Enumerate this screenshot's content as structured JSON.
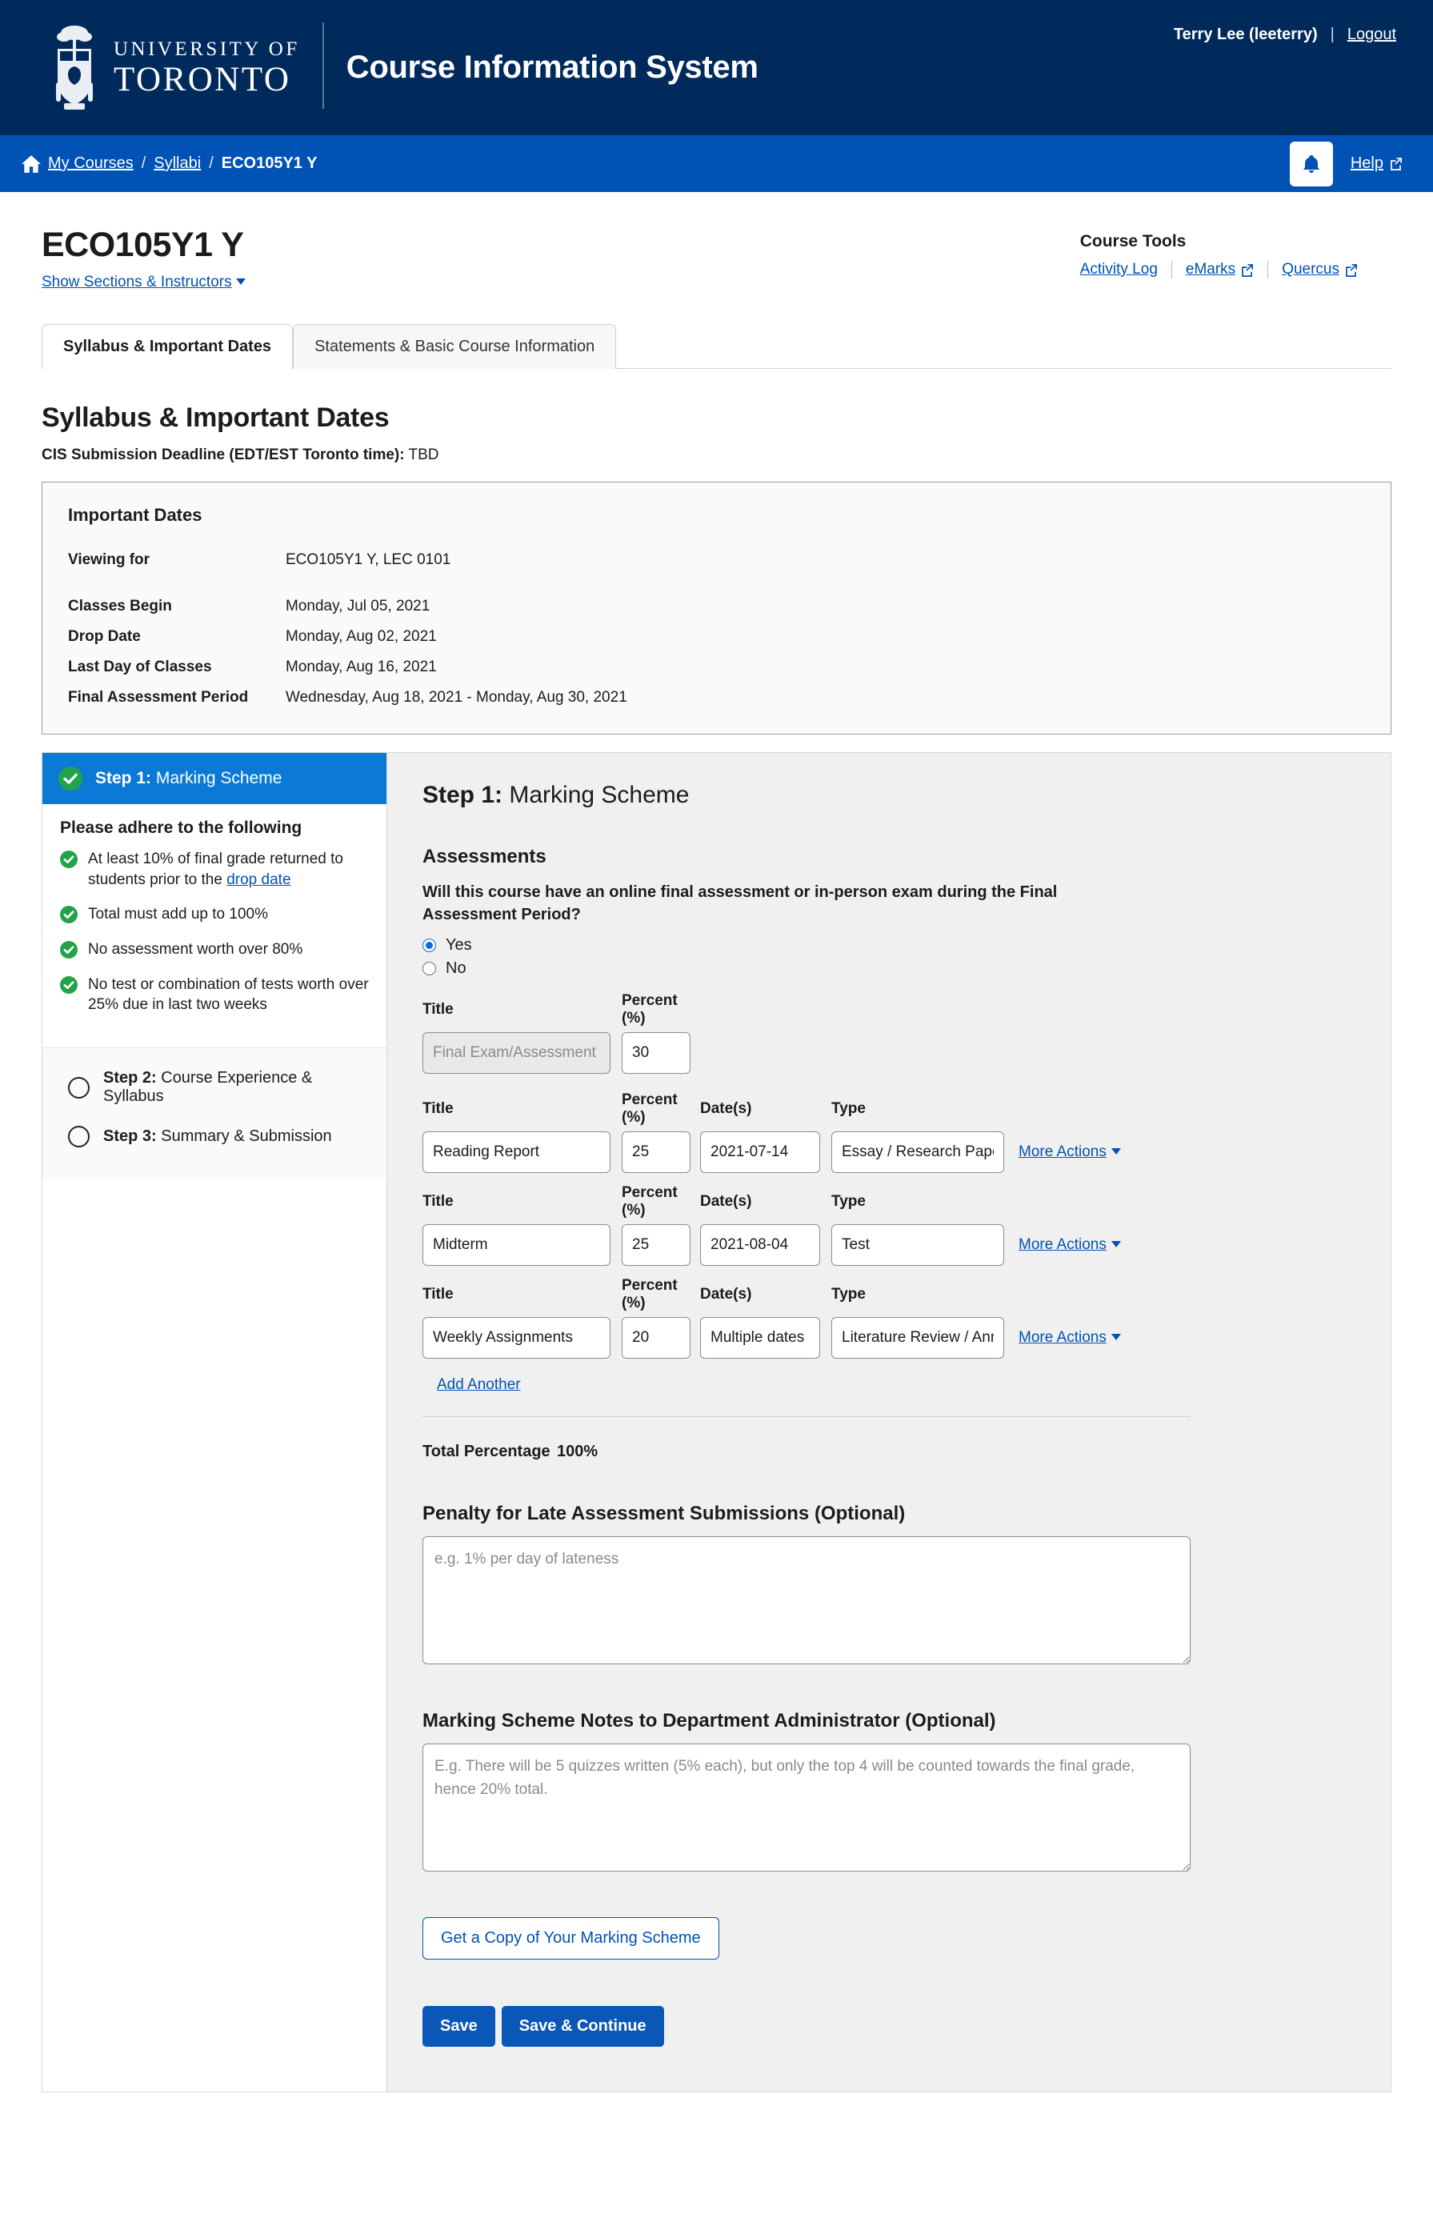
{
  "header": {
    "logo_line1": "UNIVERSITY OF",
    "logo_line2": "TORONTO",
    "app_title": "Course Information System",
    "user_name": "Terry Lee (leeterry)",
    "separator": "|",
    "logout_label": "Logout",
    "brand_navy": "#002a5c"
  },
  "breadcrumb": {
    "home_icon": "home-icon",
    "items": [
      {
        "label": "My Courses",
        "link": true
      },
      {
        "label": "Syllabi",
        "link": true
      },
      {
        "label": "ECO105Y1 Y",
        "link": false
      }
    ],
    "slash": "/",
    "help_label": "Help",
    "bell_icon": "bell-icon",
    "bar_blue": "#0052b4"
  },
  "course": {
    "title": "ECO105Y1 Y",
    "sections_link": "Show Sections & Instructors"
  },
  "course_tools": {
    "title": "Course Tools",
    "links": [
      {
        "label": "Activity Log",
        "external": false
      },
      {
        "label": "eMarks",
        "external": true
      },
      {
        "label": "Quercus",
        "external": true
      }
    ]
  },
  "tabs": [
    {
      "label": "Syllabus & Important Dates",
      "active": true
    },
    {
      "label": "Statements & Basic Course Information",
      "active": false
    }
  ],
  "section": {
    "title": "Syllabus & Important Dates",
    "deadline_label": "CIS Submission Deadline (EDT/EST Toronto time):",
    "deadline_value": "TBD"
  },
  "important_dates": {
    "heading": "Important Dates",
    "rows": [
      {
        "label": "Viewing for",
        "value": "ECO105Y1 Y, LEC 0101"
      },
      {
        "label": "Classes Begin",
        "value": "Monday, Jul 05, 2021"
      },
      {
        "label": "Drop Date",
        "value": "Monday, Aug 02, 2021"
      },
      {
        "label": "Last Day of Classes",
        "value": "Monday, Aug 16, 2021"
      },
      {
        "label": "Final Assessment Period",
        "value": "Wednesday, Aug 18, 2021 - Monday, Aug 30, 2021"
      }
    ]
  },
  "sidebar": {
    "step1_prefix": "Step 1:",
    "step1_label": "Marking Scheme",
    "adhere_heading": "Please adhere to the following",
    "rules": [
      {
        "text_before": "At least 10% of final grade returned to students prior to the ",
        "link": "drop date",
        "text_after": ""
      },
      {
        "text_before": "Total must add up to 100%",
        "link": "",
        "text_after": ""
      },
      {
        "text_before": "No assessment worth over 80%",
        "link": "",
        "text_after": ""
      },
      {
        "text_before": "No test or combination of tests worth over 25% due in last two weeks",
        "link": "",
        "text_after": ""
      }
    ],
    "other_steps": [
      {
        "prefix": "Step 2:",
        "label": " Course Experience & Syllabus"
      },
      {
        "prefix": "Step 3:",
        "label": " Summary & Submission"
      }
    ],
    "active_blue": "#0b7ad6",
    "check_green": "#22a34a"
  },
  "main": {
    "step_prefix": "Step 1:",
    "step_label": " Marking Scheme",
    "assessments_heading": "Assessments",
    "question": "Will this course have an online final assessment or in-person exam during the Final Assessment Period?",
    "radio_yes": "Yes",
    "radio_no": "No",
    "radio_selected": "Yes",
    "col_title": "Title",
    "col_percent": "Percent (%)",
    "col_dates": "Date(s)",
    "col_type": "Type",
    "final_exam": {
      "title_placeholder": "Final Exam/Assessment",
      "title_value": "",
      "percent_value": "30",
      "disabled": true
    },
    "assessment_rows": [
      {
        "title": "Reading Report",
        "percent": "25",
        "dates": "2021-07-14",
        "type": "Essay / Research Paper",
        "actions": "More Actions"
      },
      {
        "title": "Midterm",
        "percent": "25",
        "dates": "2021-08-04",
        "type": "Test",
        "actions": "More Actions"
      },
      {
        "title": "Weekly Assignments",
        "percent": "20",
        "dates": "Multiple dates",
        "type": "Literature Review / Annotated Bibliography",
        "actions": "More Actions"
      }
    ],
    "add_another": "Add Another",
    "total_label": "Total Percentage",
    "total_value": "100%",
    "penalty_heading": "Penalty for Late Assessment Submissions (Optional)",
    "penalty_placeholder": "e.g. 1% per day of lateness",
    "penalty_value": "",
    "notes_heading": "Marking Scheme Notes to Department Administrator (Optional)",
    "notes_placeholder": "E.g. There will be 5 quizzes written (5% each), but only the top 4 will be counted towards the final grade, hence 20% total.",
    "notes_value": "",
    "copy_button": "Get a Copy of Your Marking Scheme",
    "save_button": "Save",
    "save_continue_button": "Save & Continue",
    "primary_blue": "#0b57b8"
  }
}
